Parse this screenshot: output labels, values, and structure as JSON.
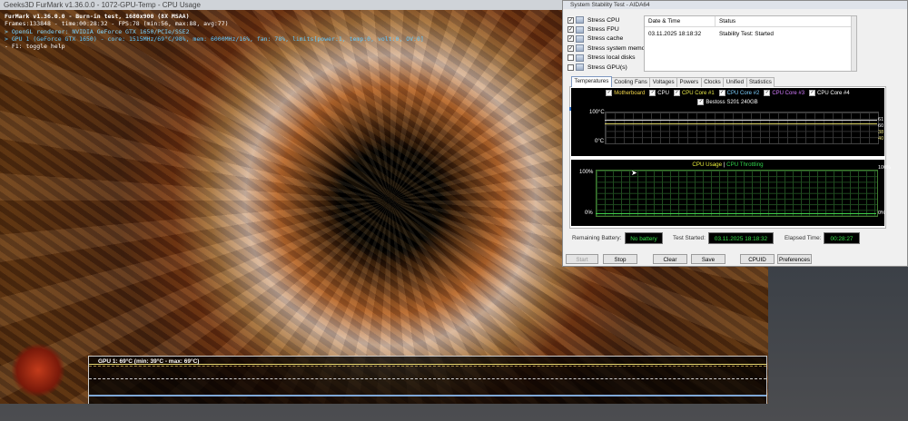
{
  "furmark": {
    "window_title": "Geeks3D FurMark v1.36.0.0 - 1072-GPU-Temp - CPU Usage",
    "hud": {
      "line1": "FurMark v1.36.0.0 - Burn-in test, 1680x900 (8X MSAA)",
      "line2": "Frames:133848 - time:00:28:32 - FPS:78 (min:56, max:88, avg:77)",
      "line3": "> OpenGL renderer: NVIDIA GeForce GTX 1650/PCIe/SSE2",
      "line4": "> GPU 1 (GeForce GTX 1650) - core: 1515MHz/69°C/98%, mem: 6000MHz/16%, fan: 78%, limits[power:1, temp:0, volt:0, OV:0]",
      "line5": "- F1: toggle help"
    },
    "graph_label": "GPU 1: 69°C (min: 39°C - max: 69°C)"
  },
  "aida": {
    "window_title": "System Stability Test - AIDA64",
    "stress_items": [
      {
        "label": "Stress CPU",
        "checked": true,
        "icon": "cpu-icon"
      },
      {
        "label": "Stress FPU",
        "checked": true,
        "icon": "fpu-icon"
      },
      {
        "label": "Stress cache",
        "checked": true,
        "icon": "cache-icon"
      },
      {
        "label": "Stress system memory",
        "checked": true,
        "icon": "memory-icon"
      },
      {
        "label": "Stress local disks",
        "checked": false,
        "icon": "disk-icon"
      },
      {
        "label": "Stress GPU(s)",
        "checked": false,
        "icon": "gpu-icon"
      }
    ],
    "log": {
      "col_date": "Date & Time",
      "col_status": "Status",
      "date": "03.11.2025 18:18:32",
      "status": "Stability Test: Started"
    },
    "tabs": [
      "Temperatures",
      "Cooling Fans",
      "Voltages",
      "Powers",
      "Clocks",
      "Unified",
      "Statistics"
    ],
    "active_tab": "Temperatures",
    "temp_legend": [
      {
        "label": "Motherboard",
        "color": "#f5d84a"
      },
      {
        "label": "CPU",
        "color": "#ffffff"
      },
      {
        "label": "CPU Core #1",
        "color": "#e8e84a"
      },
      {
        "label": "CPU Core #2",
        "color": "#7fd0ff"
      },
      {
        "label": "CPU Core #3",
        "color": "#d47cff"
      },
      {
        "label": "CPU Core #4",
        "color": "#ffffff"
      }
    ],
    "temp_legend2": "Bestoss S201 240GB",
    "temp_axis_top": "100°C",
    "temp_axis_bottom": "0°C",
    "temp_readout_a": "61 60",
    "temp_readout_b": "38 40",
    "usage_title_a": "CPU Usage",
    "usage_title_sep": "|",
    "usage_title_b": "CPU Throttling",
    "usage_axis_top_left": "100%",
    "usage_axis_bottom_left": "0%",
    "usage_axis_top_right": "100%",
    "usage_axis_bottom_right": "0%",
    "remaining_battery_label": "Remaining Battery:",
    "remaining_battery_value": "No battery",
    "test_started_label": "Test Started:",
    "test_started_value": "03.11.2025 18:18:32",
    "elapsed_time_label": "Elapsed Time:",
    "elapsed_time_value": "00:28:27",
    "buttons": {
      "start": "Start",
      "stop": "Stop",
      "clear": "Clear",
      "save": "Save",
      "cpuid": "CPUID",
      "preferences": "Preferences"
    }
  }
}
